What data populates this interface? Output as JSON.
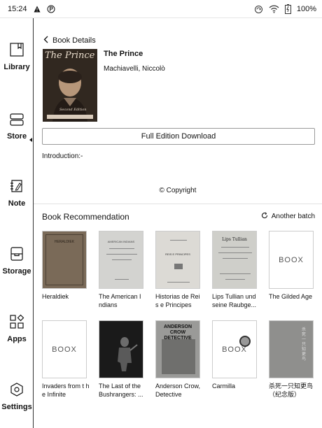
{
  "status": {
    "time": "15:24",
    "battery": "100%"
  },
  "sidebar": {
    "items": [
      {
        "label": "Library",
        "icon": "bookmark-book-icon"
      },
      {
        "label": "Store",
        "icon": "store-icon"
      },
      {
        "label": "Note",
        "icon": "note-pen-icon"
      },
      {
        "label": "Storage",
        "icon": "storage-icon"
      },
      {
        "label": "Apps",
        "icon": "apps-grid-icon"
      },
      {
        "label": "Settings",
        "icon": "settings-hexagon-icon"
      }
    ],
    "active": "Store"
  },
  "header": {
    "back_label": "Book Details"
  },
  "book": {
    "title": "The Prince",
    "author": "Machiavelli, Niccolò",
    "cover_title": "The Prince",
    "cover_edition": "Second Edition"
  },
  "download_button": "Full Edition Download",
  "introduction": "Introduction:-",
  "copyright": "© Copyright",
  "recommendation": {
    "title": "Book Recommendation",
    "another_batch": "Another batch",
    "books": [
      {
        "title": "Heraldiek",
        "cover": "HERALDIEK"
      },
      {
        "title": "The American I ndians",
        "cover": "AMERICAN INDIANS"
      },
      {
        "title": "Historias de Rei s e Principes",
        "cover": "REIS E PRINCIPES"
      },
      {
        "title": "Lips Tullian und seine Raubge...",
        "cover": "Lips Tullian"
      },
      {
        "title": "The Gilded Age",
        "cover": "BOOX"
      },
      {
        "title": "Invaders from t he Infinite",
        "cover": "BOOX"
      },
      {
        "title": "The Last of the Bushrangers: ...",
        "cover": ""
      },
      {
        "title": "Anderson Crow, Detective",
        "cover": "ANDERSON CROW DETECTIVE"
      },
      {
        "title": "Carmilla",
        "cover": "BOOX"
      },
      {
        "title": "杀死一只知更鸟（纪念版）",
        "cover": "杀死一只知更鸟"
      }
    ]
  }
}
